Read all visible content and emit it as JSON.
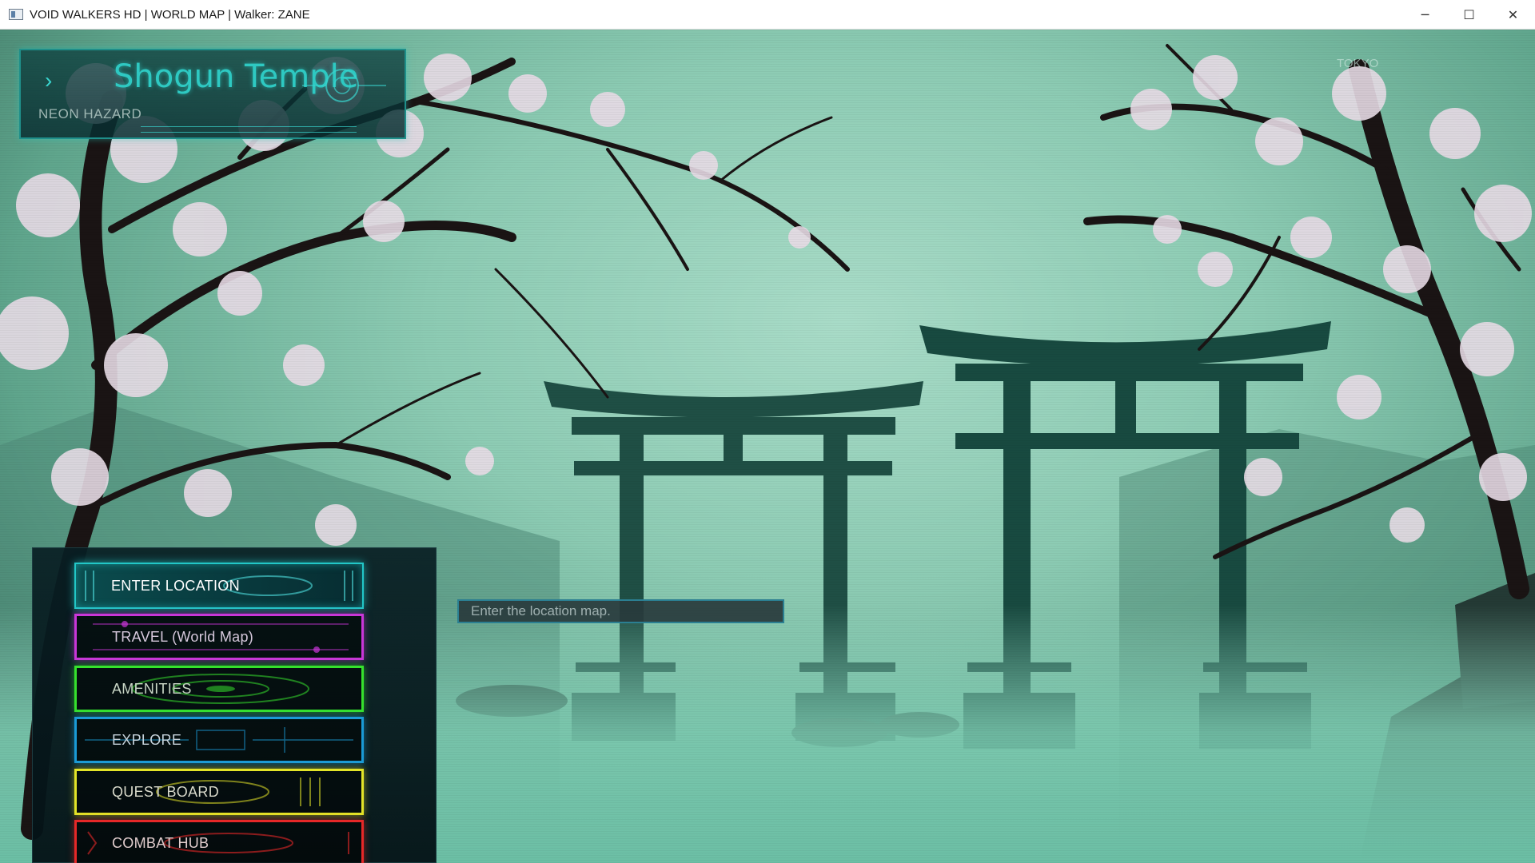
{
  "window": {
    "title": "VOID WALKERS HD  |  WORLD MAP  |  Walker: ZANE",
    "controls": {
      "minimize": "─",
      "maximize": "☐",
      "close": "✕"
    }
  },
  "location": {
    "name": "Shogun Temple",
    "subtitle": "NEON HAZARD",
    "corner_text": "TOKYO"
  },
  "menu": {
    "buttons": [
      {
        "label": "ENTER LOCATION",
        "color": "#22c7c7"
      },
      {
        "label": "TRAVEL (World Map)",
        "color": "#c936d8"
      },
      {
        "label": "AMENITIES",
        "color": "#36e12d"
      },
      {
        "label": "EXPLORE",
        "color": "#1a9ad6"
      },
      {
        "label": "QUEST BOARD",
        "color": "#e3e428"
      },
      {
        "label": "COMBAT HUB",
        "color": "#e62828"
      }
    ]
  },
  "hint": {
    "text": "Enter the location map."
  }
}
